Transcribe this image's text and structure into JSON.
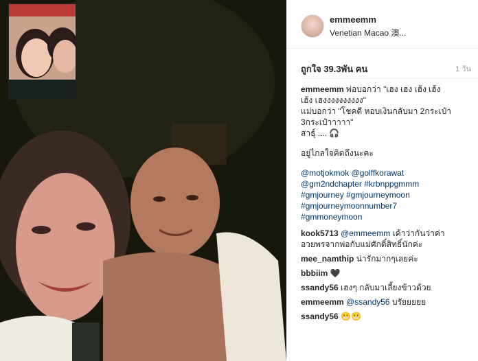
{
  "post": {
    "username": "emmeemm",
    "location": "Venetian Macao 澳...",
    "likes": "ถูกใจ 39.3พัน คน",
    "age": "1 วัน"
  },
  "caption": {
    "username": "emmeemm",
    "line1": "พ่อบอกว่า \"เฮง เฮง เฮ้ง เฮ้ง",
    "line2": "เฮ้ง เฮงงงงงงงงงง\"",
    "line3": "แม่บอกว่า \"โชคดี หอบเงินกลับมา 2กระเป๋า",
    "line4": "3กระเป๋าาาาา\"",
    "line5": "สาธุ์ .... 🎧",
    "line6": "อยู่ไกลใจคิดถึงนะคะ",
    "tags": [
      "@motjokmok @golffkorawat",
      "@gm2ndchapter #krbnppgmmm",
      "#gmjourney #gmjourneymoon",
      "#gmjourneymoonnumber7",
      "#gmmoneymoon"
    ]
  },
  "comments": [
    {
      "user": "kook5713",
      "mention": "@emmeemm",
      "text": "เค้าว่ากันว่าค่า",
      "text2": "อวยพรจากพ่อกับแม่ศักดิ์สิทธิ์นักค่ะ"
    },
    {
      "user": "mee_namthip",
      "mention": "",
      "text": "น่ารักมากๆเลยค่ะ",
      "text2": ""
    },
    {
      "user": "bbbiim",
      "mention": "",
      "text": "🖤",
      "text2": ""
    },
    {
      "user": "ssandy56",
      "mention": "",
      "text": "เฮงๆ กลับมาเลี้ยงข้าวด้วย",
      "text2": ""
    },
    {
      "user": "emmeemm",
      "mention": "@ssandy56",
      "text": "บรัยยยยย",
      "text2": ""
    },
    {
      "user": "ssandy56",
      "mention": "",
      "text": "😬😬",
      "text2": ""
    }
  ]
}
